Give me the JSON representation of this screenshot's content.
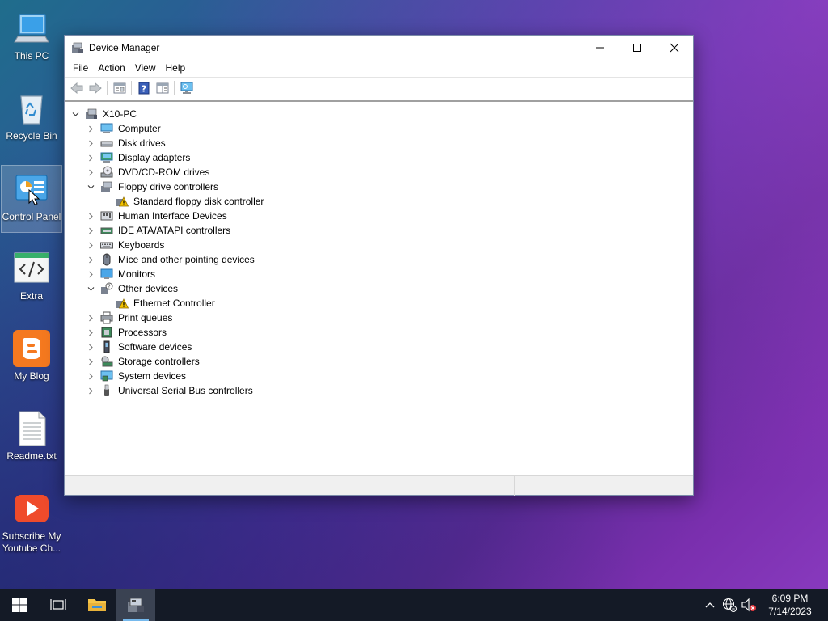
{
  "desktop": {
    "icons": [
      {
        "label": "This PC"
      },
      {
        "label": "Recycle Bin"
      },
      {
        "label": "Control Panel"
      },
      {
        "label": "Extra"
      },
      {
        "label": "My Blog"
      },
      {
        "label": "Readme.txt"
      },
      {
        "label": "Subscribe My Youtube Ch..."
      }
    ]
  },
  "window": {
    "title": "Device Manager",
    "menu": [
      "File",
      "Action",
      "View",
      "Help"
    ],
    "tree": {
      "root": "X10-PC",
      "items": [
        {
          "label": "Computer",
          "expanded": false
        },
        {
          "label": "Disk drives",
          "expanded": false
        },
        {
          "label": "Display adapters",
          "expanded": false
        },
        {
          "label": "DVD/CD-ROM drives",
          "expanded": false
        },
        {
          "label": "Floppy drive controllers",
          "expanded": true
        },
        {
          "label": "Standard floppy disk controller",
          "child": true,
          "warning": true
        },
        {
          "label": "Human Interface Devices",
          "expanded": false
        },
        {
          "label": "IDE ATA/ATAPI controllers",
          "expanded": false
        },
        {
          "label": "Keyboards",
          "expanded": false
        },
        {
          "label": "Mice and other pointing devices",
          "expanded": false
        },
        {
          "label": "Monitors",
          "expanded": false
        },
        {
          "label": "Other devices",
          "expanded": true
        },
        {
          "label": "Ethernet Controller",
          "child": true,
          "warning": true
        },
        {
          "label": "Print queues",
          "expanded": false
        },
        {
          "label": "Processors",
          "expanded": false
        },
        {
          "label": "Software devices",
          "expanded": false
        },
        {
          "label": "Storage controllers",
          "expanded": false
        },
        {
          "label": "System devices",
          "expanded": false
        },
        {
          "label": "Universal Serial Bus controllers",
          "expanded": false
        }
      ]
    }
  },
  "taskbar": {
    "time": "6:09 PM",
    "date": "7/14/2023"
  },
  "colors": {
    "accent": "#76b9ed",
    "taskbar": "#141a26",
    "warning": "#f2c200"
  }
}
